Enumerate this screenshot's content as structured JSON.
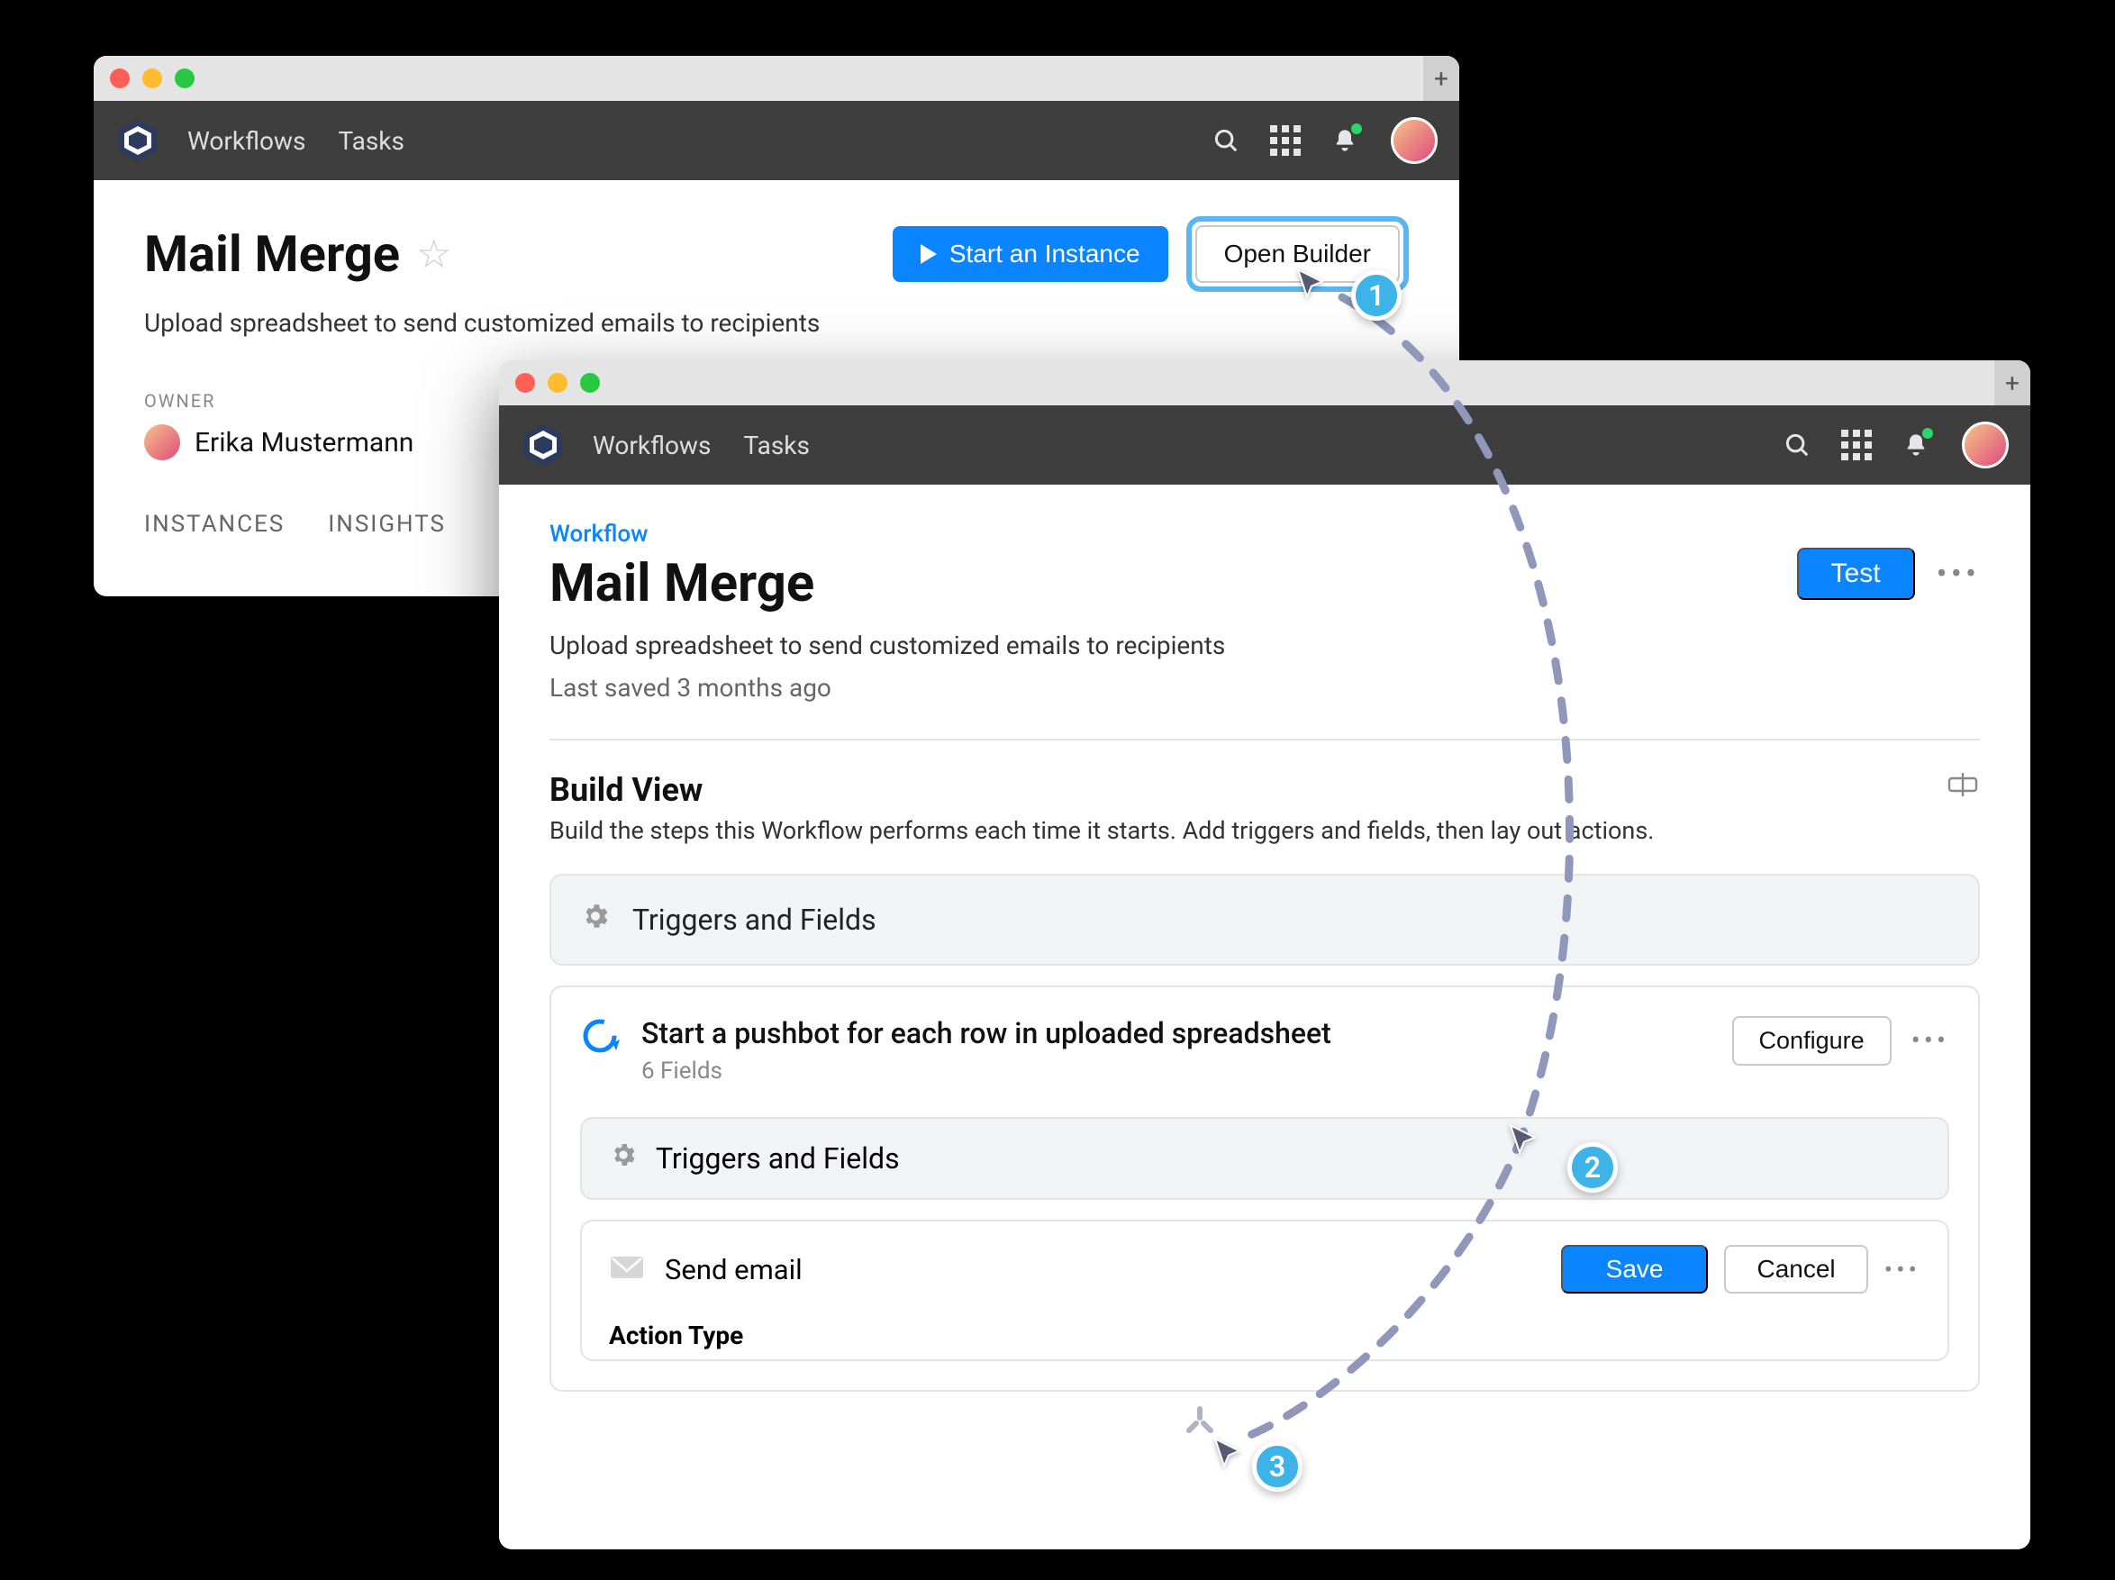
{
  "nav": {
    "links": [
      "Workflows",
      "Tasks"
    ]
  },
  "windowA": {
    "title": "Mail Merge",
    "subtitle": "Upload spreadsheet to send customized emails to recipients",
    "start_label": "Start an Instance",
    "open_label": "Open Builder",
    "owner_label": "OWNER",
    "owner_name": "Erika Mustermann",
    "tabs": [
      "INSTANCES",
      "INSIGHTS"
    ]
  },
  "windowB": {
    "crumb": "Workflow",
    "title": "Mail Merge",
    "test_label": "Test",
    "desc": "Upload spreadsheet to send customized emails to recipients",
    "saved": "Last saved 3 months ago",
    "build_title": "Build View",
    "build_desc": "Build the steps this Workflow performs each time it starts. Add triggers and fields, then lay out actions.",
    "triggers_label": "Triggers and Fields",
    "action1_title": "Start a pushbot for each row in uploaded spreadsheet",
    "action1_sub": "6 Fields",
    "configure_label": "Configure",
    "inner_triggers_label": "Triggers and Fields",
    "send_email_label": "Send email",
    "save_label": "Save",
    "cancel_label": "Cancel",
    "action_type_label": "Action Type"
  },
  "annotations": {
    "n1": "1",
    "n2": "2",
    "n3": "3"
  }
}
